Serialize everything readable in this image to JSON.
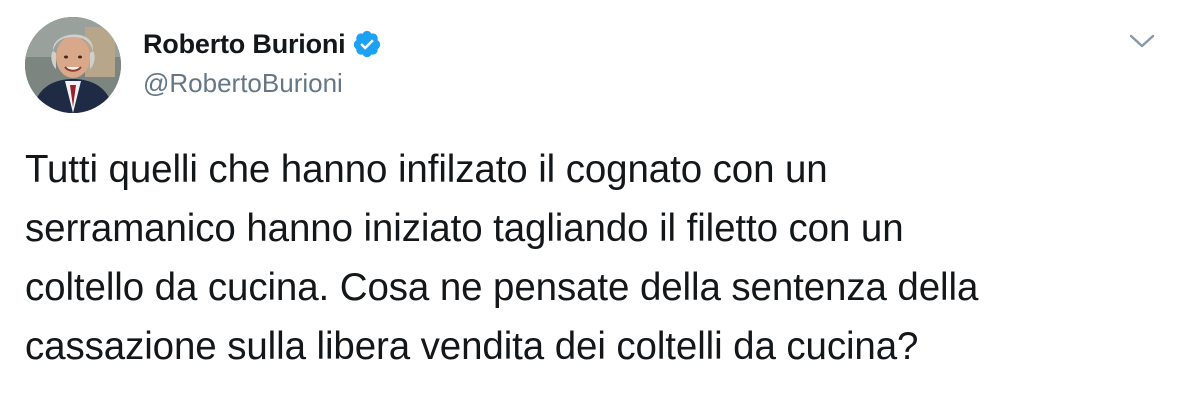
{
  "tweet": {
    "author": {
      "display_name": "Roberto Burioni",
      "handle": "@RobertoBurioni",
      "verified_icon": "verified-badge-icon",
      "verified_color": "#1da1f2"
    },
    "more_menu_icon": "chevron-down-icon",
    "text_lines": [
      "Tutti quelli che hanno infilzato il cognato con un",
      "serramanico hanno iniziato tagliando il filetto con un",
      "coltello da cucina. Cosa ne pensate della sentenza della",
      "cassazione sulla libera vendita dei coltelli da cucina?"
    ]
  },
  "colors": {
    "text_primary": "#14171a",
    "text_secondary": "#657786",
    "background": "#ffffff"
  }
}
